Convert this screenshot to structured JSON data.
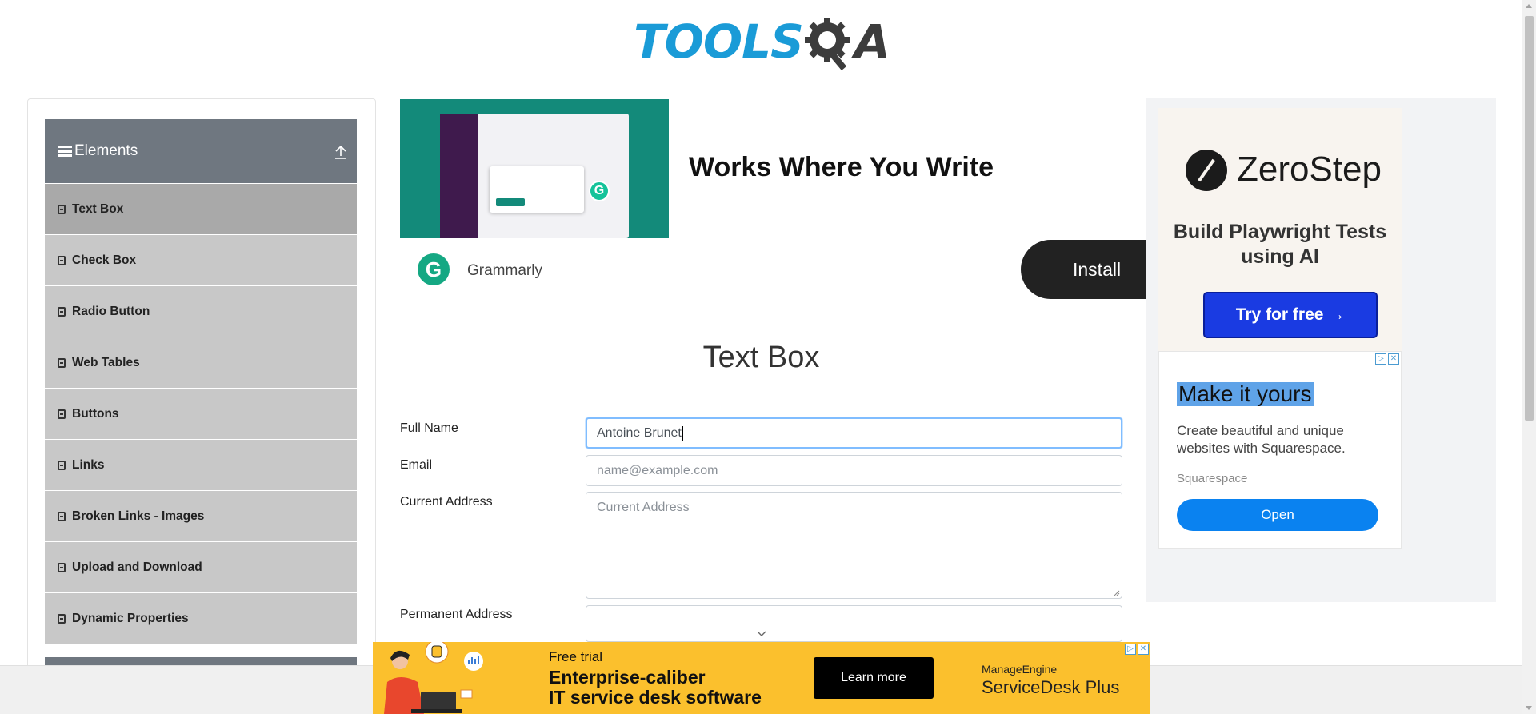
{
  "logo": {
    "text_main": "TOOLS",
    "text_q": "Q",
    "text_a": "A"
  },
  "sidebar": {
    "group_title": "Elements",
    "items": [
      {
        "label": "Text Box",
        "active": true
      },
      {
        "label": "Check Box"
      },
      {
        "label": "Radio Button"
      },
      {
        "label": "Web Tables"
      },
      {
        "label": "Buttons"
      },
      {
        "label": "Links"
      },
      {
        "label": "Broken Links - Images"
      },
      {
        "label": "Upload and Download"
      },
      {
        "label": "Dynamic Properties"
      }
    ]
  },
  "ad_top": {
    "headline": "Works Where You Write",
    "brand": "Grammarly",
    "install_label": "Install",
    "logo_letter": "G"
  },
  "main": {
    "title": "Text Box",
    "fields": {
      "full_name": {
        "label": "Full Name",
        "value": "Antoine Brunet"
      },
      "email": {
        "label": "Email",
        "placeholder": "name@example.com"
      },
      "current_address": {
        "label": "Current Address",
        "placeholder": "Current Address"
      },
      "permanent_address": {
        "label": "Permanent Address"
      }
    }
  },
  "ad_right": {
    "zerostep": {
      "name": "ZeroStep",
      "subtitle": "Build Playwright Tests using AI",
      "button": "Try for free →"
    },
    "squarespace": {
      "title": "Make it yours",
      "description": "Create beautiful and unique websites with Squarespace.",
      "brand": "Squarespace",
      "button": "Open"
    }
  },
  "ad_bottom": {
    "small": "Free trial",
    "line1": "Enterprise-caliber",
    "line2": "IT service desk software",
    "button": "Learn more",
    "brand_small": "ManageEngine",
    "brand_big": "ServiceDesk Plus"
  },
  "colors": {
    "accent": "#1a9bd7",
    "sidebar_header": "#6f7780",
    "menu_item": "#c8c8c8",
    "menu_active": "#a9a9a9",
    "ad_yellow": "#fbc02d"
  }
}
